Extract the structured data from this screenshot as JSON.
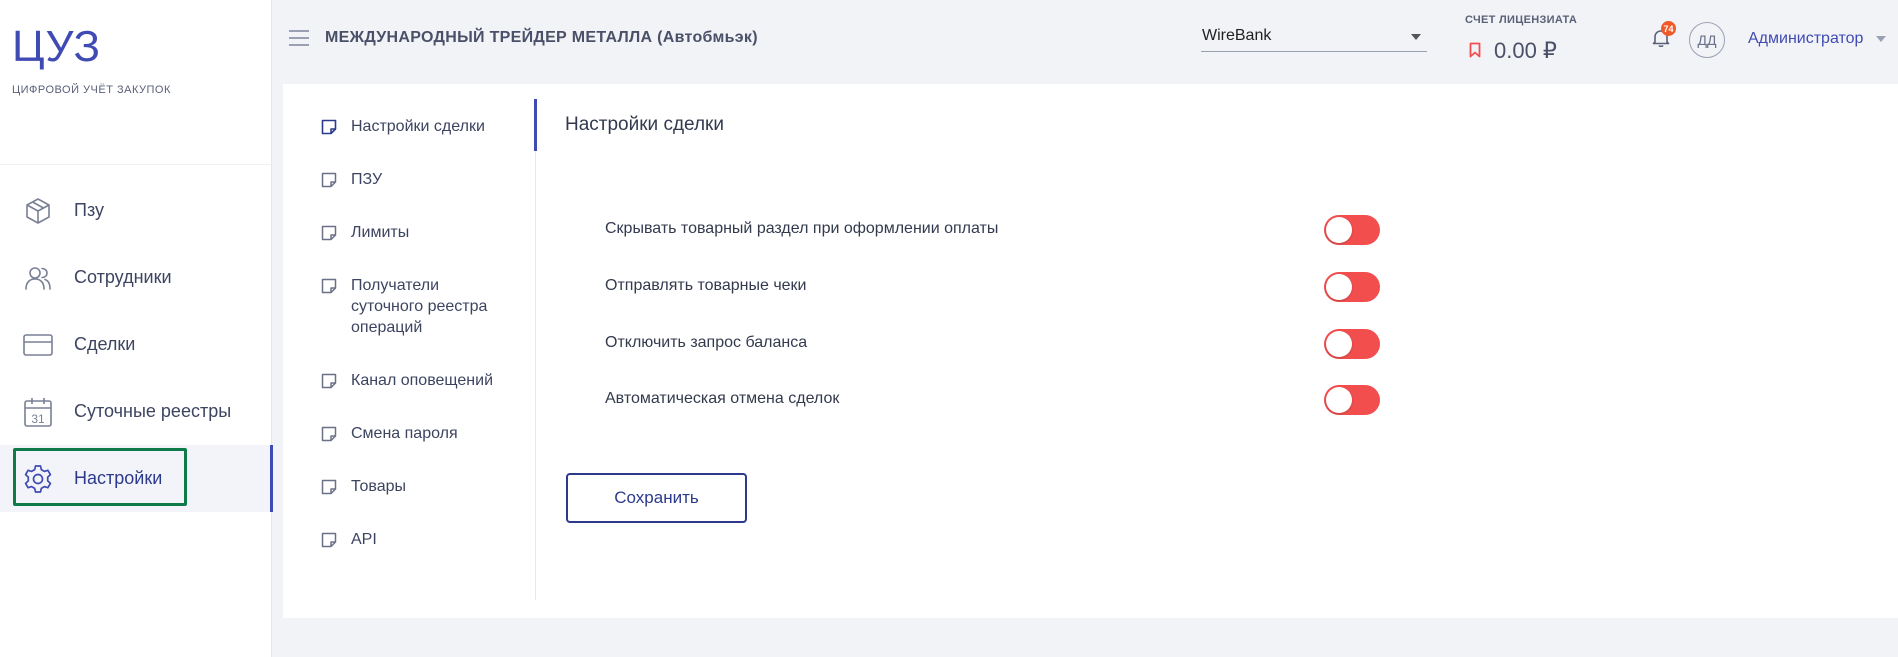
{
  "brand": {
    "logo": "ЦУЗ",
    "subtitle": "ЦИФРОВОЙ УЧЁТ ЗАКУПОК",
    "color": "#3f4bb3"
  },
  "sidebar": {
    "items": [
      {
        "label": "Пзу",
        "icon": "box-icon"
      },
      {
        "label": "Сотрудники",
        "icon": "users-icon"
      },
      {
        "label": "Сделки",
        "icon": "card-icon"
      },
      {
        "label": "Суточные реестры",
        "icon": "calendar-icon",
        "icon_text": "31"
      },
      {
        "label": "Настройки",
        "icon": "gear-icon",
        "active": true
      }
    ]
  },
  "header": {
    "company": "МЕЖДУНАРОДНЫЙ ТРЕЙДЕР МЕТАЛЛА (Автобмьэк)",
    "bank_select": "WireBank",
    "account_label": "СЧЕТ ЛИЦЕНЗИАТА",
    "account_amount": "0.00 ₽",
    "notifications_count": "74",
    "avatar_initials": "ДД",
    "user_role": "Администратор"
  },
  "sub_nav": {
    "items": [
      {
        "label": "Настройки сделки",
        "active": true
      },
      {
        "label": "ПЗУ"
      },
      {
        "label": "Лимиты"
      },
      {
        "label": "Получатели суточного реестра операций"
      },
      {
        "label": "Канал оповещений"
      },
      {
        "label": "Смена пароля"
      },
      {
        "label": "Товары"
      },
      {
        "label": "API"
      }
    ]
  },
  "main": {
    "title": "Настройки сделки",
    "settings": [
      {
        "label": "Скрывать товарный раздел при оформлении оплаты",
        "enabled": false
      },
      {
        "label": "Отправлять товарные чеки",
        "enabled": false
      },
      {
        "label": "Отключить запрос баланса",
        "enabled": false
      },
      {
        "label": "Автоматическая отмена сделок",
        "enabled": false
      }
    ],
    "save_label": "Сохранить"
  },
  "colors": {
    "accent": "#3f4bb3",
    "toggle_off": "#f24e4e",
    "badge": "#f05a28",
    "focus_outline": "#0f7a4a"
  }
}
